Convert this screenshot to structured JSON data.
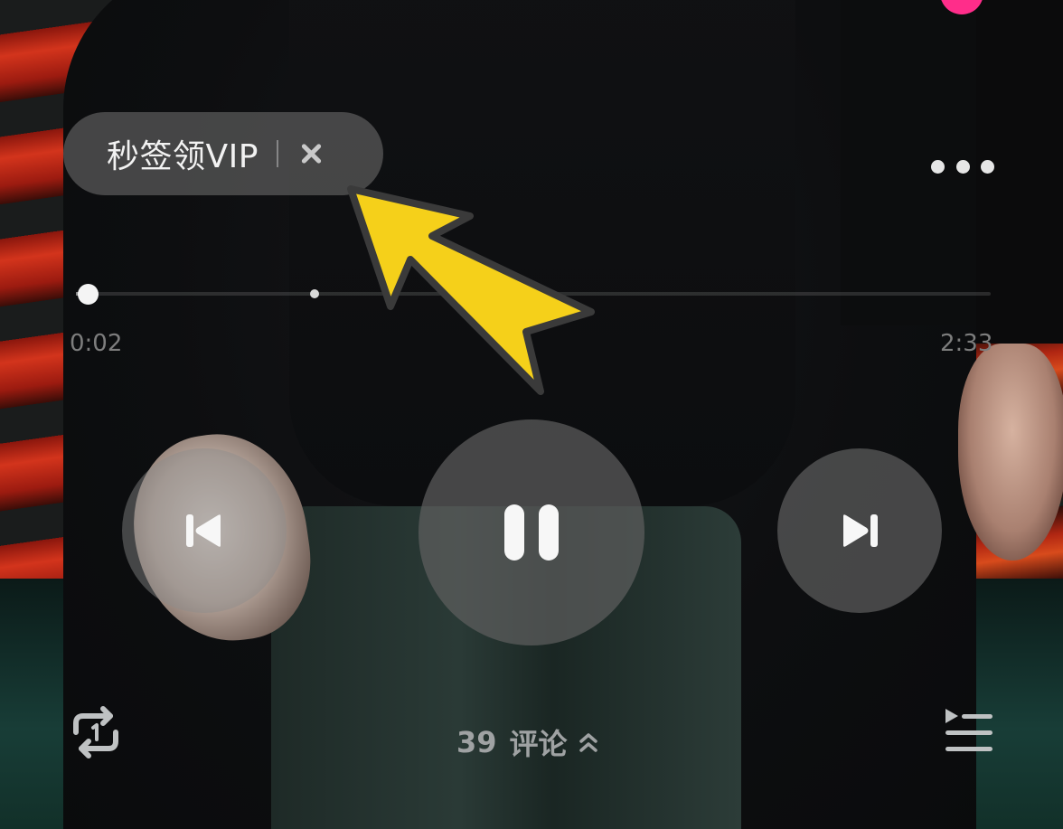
{
  "promo": {
    "text": "秒签领VIP"
  },
  "progress": {
    "current_time": "0:02",
    "total_time": "2:33",
    "fraction": 0.013
  },
  "comments": {
    "count": "39",
    "label": "评论"
  },
  "colors": {
    "accent_arrow": "#f5d01a",
    "pill_bg": "#5c5c5c",
    "pink": "#ff2d8a"
  },
  "icons": {
    "close": "close-icon",
    "more": "more-dots-icon",
    "prev": "skip-previous-icon",
    "pause": "pause-icon",
    "next": "skip-next-icon",
    "repeat": "repeat-one-icon",
    "playlist": "playlist-icon",
    "expand": "chevron-up-icon"
  }
}
